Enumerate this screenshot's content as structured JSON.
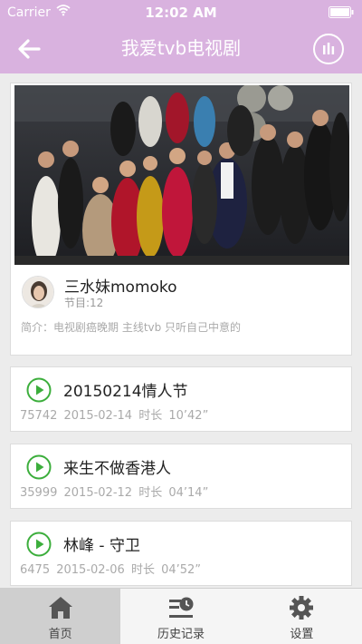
{
  "status_bar": {
    "carrier": "Carrier",
    "time": "12:02 AM"
  },
  "nav": {
    "title": "我爱tvb电视剧"
  },
  "program": {
    "name": "三水妹momoko",
    "episode_count": "节目:12",
    "intro": "简介：电视剧癌晚期 主线tvb 只听自己中意的"
  },
  "episodes": [
    {
      "title": "20150214情人节",
      "plays": "75742",
      "date": "2015-02-14",
      "duration_label": "时长",
      "duration": "10’42”"
    },
    {
      "title": "来生不做香港人",
      "plays": "35999",
      "date": "2015-02-12",
      "duration_label": "时长",
      "duration": "04’14”"
    },
    {
      "title": "林峰 - 守卫",
      "plays": "6475",
      "date": "2015-02-06",
      "duration_label": "时长",
      "duration": "04’52”"
    }
  ],
  "tabs": [
    {
      "label": "首页",
      "icon": "home-icon",
      "active": true
    },
    {
      "label": "历史记录",
      "icon": "history-icon",
      "active": false
    },
    {
      "label": "设置",
      "icon": "gear-icon",
      "active": false
    }
  ],
  "colors": {
    "header": "#d9b2df",
    "play": "#3cae3c",
    "tab_active": "#cfcfcf"
  }
}
